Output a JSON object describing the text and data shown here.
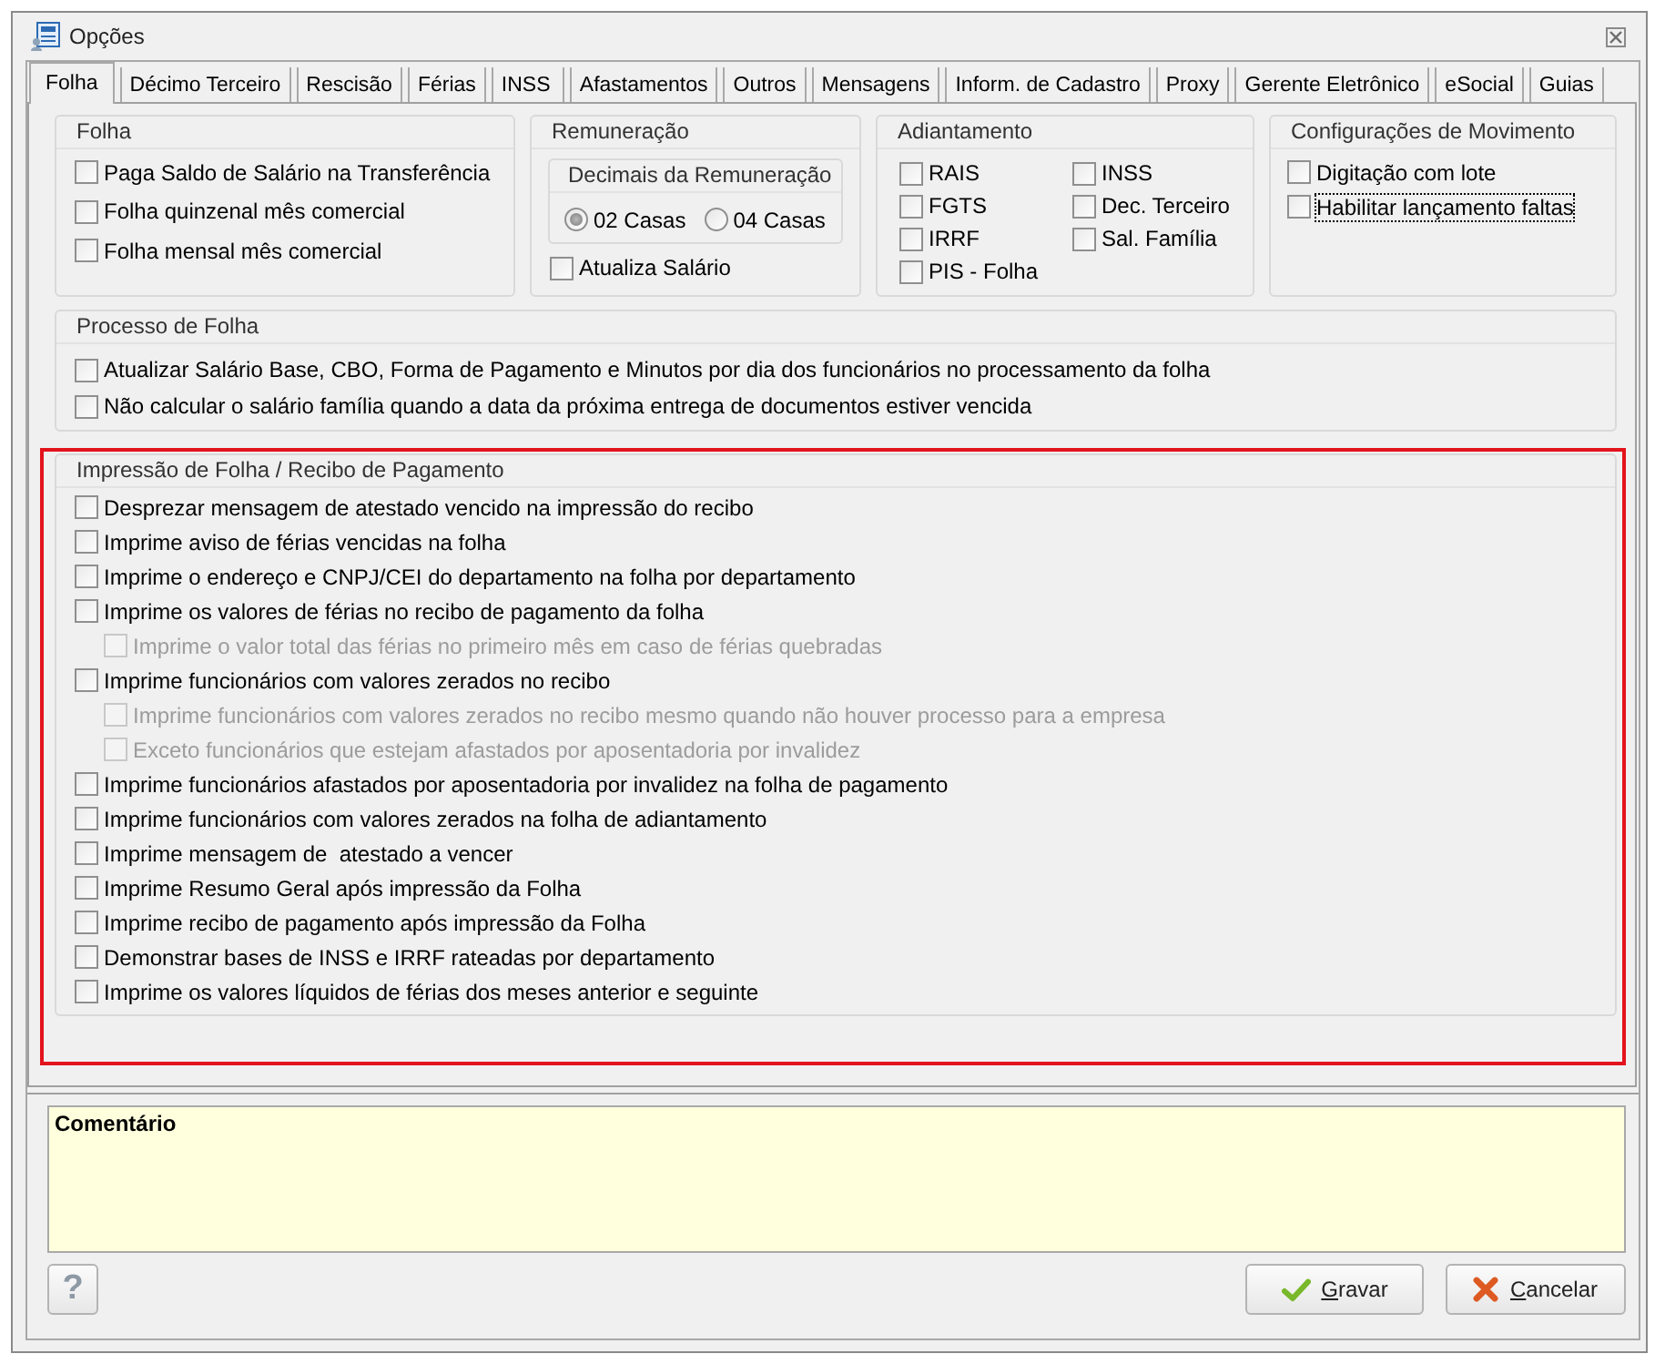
{
  "window": {
    "title": "Opções"
  },
  "tabs": [
    {
      "label": "Folha",
      "selected": true
    },
    {
      "label": "Décimo Terceiro",
      "selected": false
    },
    {
      "label": "Rescisão",
      "selected": false
    },
    {
      "label": "Férias",
      "selected": false
    },
    {
      "label": "INSS",
      "selected": false
    },
    {
      "label": "Afastamentos",
      "selected": false
    },
    {
      "label": "Outros",
      "selected": false
    },
    {
      "label": "Mensagens",
      "selected": false
    },
    {
      "label": "Inform. de Cadastro",
      "selected": false
    },
    {
      "label": "Proxy",
      "selected": false
    },
    {
      "label": "Gerente Eletrônico",
      "selected": false
    },
    {
      "label": "eSocial",
      "selected": false
    },
    {
      "label": "Guias",
      "selected": false
    }
  ],
  "folha": {
    "title": "Folha",
    "options": [
      {
        "label": "Paga Saldo de Salário na Transferência",
        "checked": false
      },
      {
        "label": "Folha quinzenal mês comercial",
        "checked": false
      },
      {
        "label": "Folha mensal mês comercial",
        "checked": false
      }
    ]
  },
  "remuneracao": {
    "title": "Remuneração",
    "decimais": {
      "title": "Decimais da Remuneração",
      "options": [
        {
          "label": "02 Casas",
          "selected": true
        },
        {
          "label": "04 Casas",
          "selected": false
        }
      ]
    },
    "options": [
      {
        "label": "Atualiza Salário",
        "checked": false
      }
    ]
  },
  "adiantamento": {
    "title": "Adiantamento",
    "columns": [
      {
        "options": [
          {
            "label": "RAIS",
            "checked": false
          },
          {
            "label": "FGTS",
            "checked": false
          },
          {
            "label": "IRRF",
            "checked": false
          },
          {
            "label": "PIS - Folha",
            "checked": false
          }
        ]
      },
      {
        "options": [
          {
            "label": "INSS",
            "checked": false
          },
          {
            "label": "Dec. Terceiro",
            "checked": false
          },
          {
            "label": "Sal. Família",
            "checked": false
          }
        ]
      }
    ]
  },
  "movimento": {
    "title": "Configurações de Movimento",
    "options": [
      {
        "label": "Digitação com lote",
        "checked": false,
        "focused": false
      },
      {
        "label": "Habilitar lançamento faltas",
        "checked": false,
        "focused": true
      }
    ]
  },
  "processo": {
    "title": "Processo de Folha",
    "options": [
      {
        "label": "Atualizar Salário Base, CBO, Forma de Pagamento e Minutos por dia dos funcionários no processamento da folha",
        "checked": false
      },
      {
        "label": "Não calcular o salário família quando a data da próxima entrega de documentos estiver vencida",
        "checked": false
      }
    ]
  },
  "impressao": {
    "title": "Impressão de Folha / Recibo de Pagamento",
    "highlighted": true,
    "options": [
      {
        "label": "Desprezar mensagem de atestado vencido na impressão do recibo",
        "checked": false,
        "disabled": false
      },
      {
        "label": "Imprime aviso de férias vencidas na folha",
        "checked": false,
        "disabled": false
      },
      {
        "label": "Imprime o endereço e CNPJ/CEI do departamento na folha por departamento",
        "checked": false,
        "disabled": false
      },
      {
        "label": "Imprime os valores de férias no recibo de pagamento da folha",
        "checked": false,
        "disabled": false,
        "children": [
          {
            "label": "Imprime o valor total das férias no primeiro mês em caso de férias quebradas",
            "checked": false,
            "disabled": true
          }
        ]
      },
      {
        "label": "Imprime funcionários com valores zerados no recibo",
        "checked": false,
        "disabled": false,
        "children": [
          {
            "label": "Imprime funcionários com valores zerados no recibo mesmo quando não houver processo para a empresa",
            "checked": false,
            "disabled": true
          },
          {
            "label": "Exceto funcionários que estejam afastados por aposentadoria por invalidez",
            "checked": false,
            "disabled": true
          }
        ]
      },
      {
        "label": "Imprime funcionários afastados por aposentadoria por invalidez na folha de pagamento",
        "checked": false,
        "disabled": false
      },
      {
        "label": "Imprime funcionários com valores zerados na folha de adiantamento",
        "checked": false,
        "disabled": false
      },
      {
        "label": "Imprime mensagem de  atestado a vencer",
        "checked": false,
        "disabled": false
      },
      {
        "label": "Imprime Resumo Geral após impressão da Folha",
        "checked": false,
        "disabled": false
      },
      {
        "label": "Imprime recibo de pagamento após impressão da Folha",
        "checked": false,
        "disabled": false
      },
      {
        "label": "Demonstrar bases de INSS e IRRF rateadas por departamento",
        "checked": false,
        "disabled": false
      },
      {
        "label": "Imprime os valores líquidos de férias dos meses anterior e seguinte",
        "checked": false,
        "disabled": false
      }
    ]
  },
  "comment": {
    "label": "Comentário"
  },
  "buttons": [
    {
      "kind": "help",
      "label": "?",
      "underline_first": false
    },
    {
      "kind": "confirm",
      "label": "Gravar",
      "underline_first": true
    },
    {
      "kind": "cancel",
      "label": "Cancelar",
      "underline_first": true
    }
  ]
}
